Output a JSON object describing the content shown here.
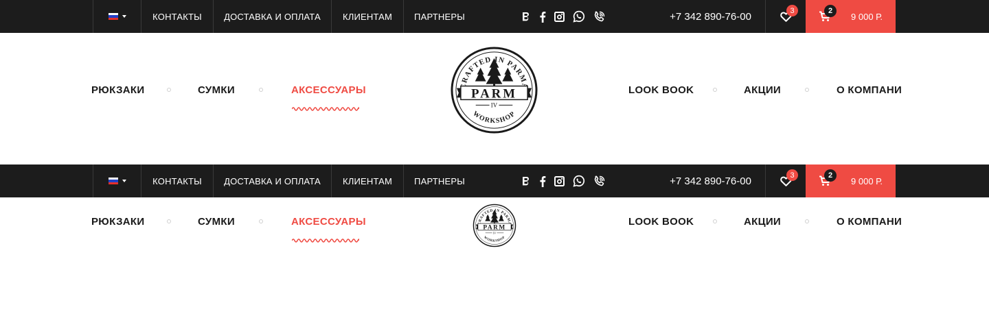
{
  "topbar": {
    "language": {
      "flag": "ru-flag",
      "colors": [
        "#ffffff",
        "#2340c8",
        "#e5302b"
      ]
    },
    "nav": [
      "КОНТАКТЫ",
      "ДОСТАВКА И ОПЛАТА",
      "КЛИЕНТАМ",
      "ПАРТНЕРЫ"
    ],
    "social": [
      "vk-icon",
      "facebook-icon",
      "instagram-icon",
      "whatsapp-icon",
      "viber-icon"
    ],
    "phone": "+7 342 890-76-00",
    "favorites_count": "3",
    "cart_count": "2",
    "cart_total": "9 000 Р."
  },
  "main_nav": {
    "left": [
      "РЮКЗАКИ",
      "СУМКИ",
      "АКСЕССУАРЫ"
    ],
    "right": [
      "LOOK BOOK",
      "АКЦИИ",
      "О КОМПАНИ"
    ],
    "active": "АКСЕССУАРЫ"
  },
  "logo": {
    "arc_top": "CRAFTED IN PARMA",
    "name": "PARM",
    "numeral": "IV",
    "arc_bottom": "WORKSHOP"
  },
  "colors": {
    "accent": "#ef4b43",
    "topbar_bg": "#1c1c1c",
    "text": "#1a1a1a"
  }
}
